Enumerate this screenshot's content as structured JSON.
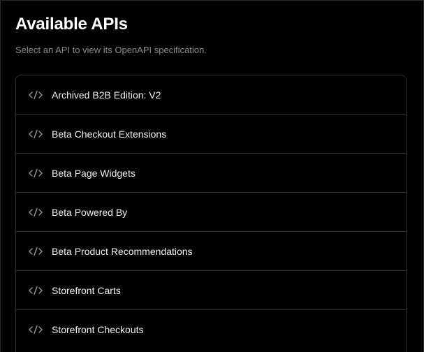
{
  "header": {
    "title": "Available APIs",
    "subtitle": "Select an API to view its OpenAPI specification."
  },
  "apis": [
    {
      "label": "Archived B2B Edition: V2",
      "icon": "code-icon"
    },
    {
      "label": "Beta Checkout Extensions",
      "icon": "code-icon"
    },
    {
      "label": "Beta Page Widgets",
      "icon": "code-icon"
    },
    {
      "label": "Beta Powered By",
      "icon": "code-icon"
    },
    {
      "label": "Beta Product Recommendations",
      "icon": "code-icon"
    },
    {
      "label": "Storefront Carts",
      "icon": "code-icon"
    },
    {
      "label": "Storefront Checkouts",
      "icon": "code-icon"
    }
  ],
  "colors": {
    "background": "#000000",
    "text": "#ffffff",
    "muted": "#8a8a8a",
    "border": "#2e2e2e"
  }
}
